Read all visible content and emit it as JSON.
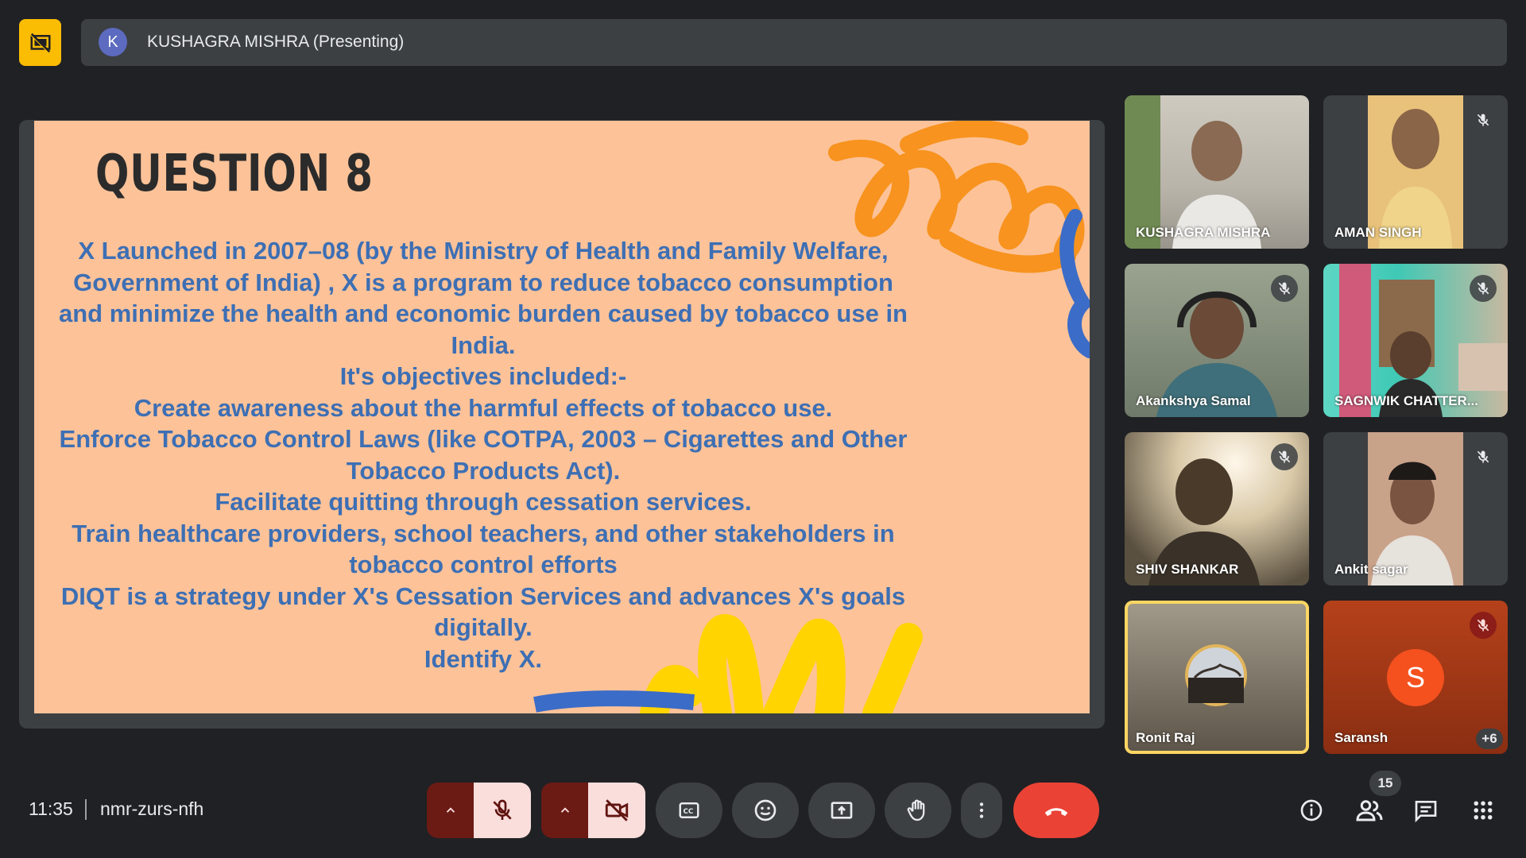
{
  "top_bar": {
    "avatar_initial": "K",
    "presenter_label": "KUSHAGRA MISHRA (Presenting)"
  },
  "slide": {
    "title": "QUESTION 8",
    "lines": [
      "X Launched in 2007–08 (by the Ministry of Health and Family Welfare,",
      "Government of India) , X is a program to reduce tobacco consumption",
      "and minimize the health and economic burden caused by tobacco use in",
      "India.",
      "It's objectives included:-",
      "Create awareness about the harmful effects of tobacco use.",
      "Enforce Tobacco Control Laws (like COTPA, 2003 – Cigarettes and Other",
      "Tobacco Products Act).",
      "Facilitate quitting through cessation services.",
      "Train healthcare providers, school teachers, and other stakeholders in",
      "tobacco control efforts",
      "DIQT is a strategy under X's Cessation Services and advances X's goals",
      "digitally.",
      "Identify X."
    ]
  },
  "participants": [
    {
      "name": "KUSHAGRA MISHRA",
      "muted": false
    },
    {
      "name": "AMAN SINGH",
      "muted": true
    },
    {
      "name": "Akankshya Samal",
      "muted": true
    },
    {
      "name": "SAGNWIK CHATTER...",
      "muted": true
    },
    {
      "name": "SHIV SHANKAR",
      "muted": true
    },
    {
      "name": "Ankit sagar",
      "muted": true
    },
    {
      "name": "Ronit Raj",
      "muted": false
    },
    {
      "name": "Saransh",
      "muted": true,
      "initial": "S"
    }
  ],
  "overflow_count": "+6",
  "bottom_bar": {
    "time": "11:35",
    "meeting_code": "nmr-zurs-nfh",
    "people_count": "15"
  },
  "colors": {
    "accent_yellow": "#fbbc04",
    "slide_bg": "#fdc298",
    "slide_text": "#3d6fb4",
    "end_call": "#ea4335",
    "mic_off_bg": "#f9dedc",
    "speaking_border": "#fdd663"
  }
}
